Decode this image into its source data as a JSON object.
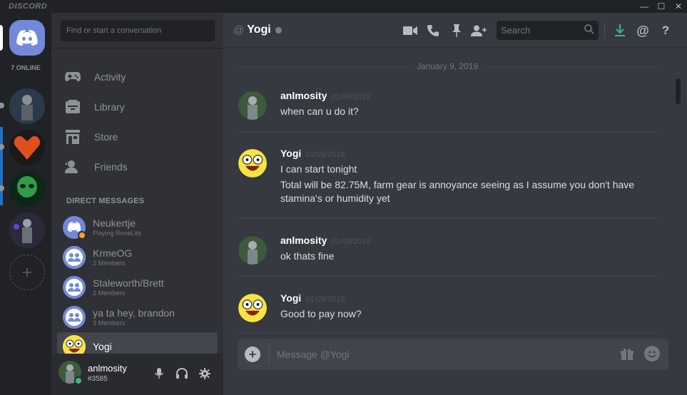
{
  "titlebar": {
    "brand": "DISCORD",
    "minimize": "—",
    "maximize": "☐",
    "close": "✕"
  },
  "guilds": {
    "online_label": "7 ONLINE"
  },
  "finder": {
    "placeholder": "Find or start a conversation"
  },
  "nav": [
    {
      "label": "Activity",
      "icon": "gamepad-icon"
    },
    {
      "label": "Library",
      "icon": "library-icon"
    },
    {
      "label": "Store",
      "icon": "store-icon"
    },
    {
      "label": "Friends",
      "icon": "friends-icon"
    }
  ],
  "direct_messages": {
    "header": "DIRECT MESSAGES",
    "items": [
      {
        "name": "Neukertje",
        "sub": "Playing RuneLite"
      },
      {
        "name": "KrmeOG",
        "sub": "2 Members"
      },
      {
        "name": "Staleworth/Brett",
        "sub": "2 Members"
      },
      {
        "name": "ya ta hey, brandon",
        "sub": "3 Members"
      },
      {
        "name": "Yogi",
        "sub": ""
      }
    ]
  },
  "user": {
    "name": "anlmosity",
    "tag": "#3585"
  },
  "chat": {
    "at": "@",
    "channel": "Yogi",
    "search_placeholder": "Search",
    "date_divider": "January 9, 2019",
    "messages": [
      {
        "author": "anlmosity",
        "time": "01/09/2019",
        "lines": [
          "when can u do it?"
        ]
      },
      {
        "author": "Yogi",
        "time": "01/09/2019",
        "lines": [
          "I can start tonight",
          "Total will be 82.75M, farm gear is annoyance seeing as I assume you don't have",
          "stamina's or humidity yet"
        ]
      },
      {
        "author": "anlmosity",
        "time": "01/09/2019",
        "lines": [
          "ok thats fine"
        ]
      },
      {
        "author": "Yogi",
        "time": "01/09/2019",
        "lines": [
          "Good to pay now?"
        ]
      }
    ],
    "composer_placeholder": "Message @Yogi"
  },
  "colors": {
    "blurple": "#7289da",
    "online": "#43b581",
    "idle": "#faa61a",
    "download": "#43b581"
  }
}
